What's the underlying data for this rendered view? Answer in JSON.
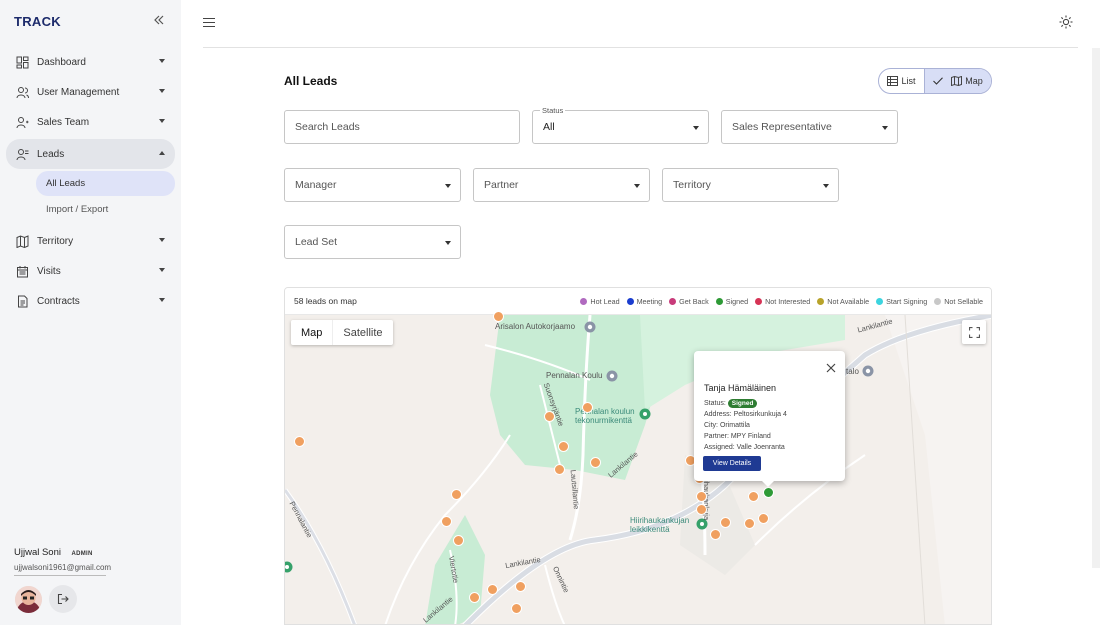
{
  "app": {
    "brand": "TRACK"
  },
  "sidebar": {
    "items": [
      {
        "label": "Dashboard",
        "icon": "dashboard-icon"
      },
      {
        "label": "User Management",
        "icon": "users-icon"
      },
      {
        "label": "Sales Team",
        "icon": "team-icon"
      },
      {
        "label": "Leads",
        "icon": "leads-icon",
        "expanded": true
      },
      {
        "label": "Territory",
        "icon": "map-icon"
      },
      {
        "label": "Visits",
        "icon": "calendar-icon"
      },
      {
        "label": "Contracts",
        "icon": "document-icon"
      }
    ],
    "sub_items": [
      "All Leads",
      "Import / Export"
    ],
    "user": {
      "name": "Ujjwal Soni",
      "role": "ADMIN",
      "email": "ujjwalsoni1961@gmail.com"
    }
  },
  "page": {
    "title": "All Leads",
    "view_toggle": {
      "list": "List",
      "map": "Map",
      "selected": "Map"
    }
  },
  "filters": {
    "search_placeholder": "Search Leads",
    "status_label": "Status",
    "status_value": "All",
    "sales_rep": "Sales Representative",
    "manager": "Manager",
    "partner": "Partner",
    "territory": "Territory",
    "lead_set": "Lead Set"
  },
  "map": {
    "count_text": "58 leads on map",
    "legend": [
      {
        "label": "Hot Lead",
        "color": "#b06abf"
      },
      {
        "label": "Meeting",
        "color": "#1a3dcf"
      },
      {
        "label": "Get Back",
        "color": "#c83b7a"
      },
      {
        "label": "Signed",
        "color": "#2e9a36"
      },
      {
        "label": "Not Interested",
        "color": "#d63355"
      },
      {
        "label": "Not Available",
        "color": "#b8a32a"
      },
      {
        "label": "Start Signing",
        "color": "#3cd4df"
      },
      {
        "label": "Not Sellable",
        "color": "#c8c8c8"
      }
    ],
    "type_buttons": [
      "Map",
      "Satellite"
    ],
    "places": [
      "Arisalon Autokorjaamo",
      "Pennalan Koulu",
      "Pennalan koulun tekonurmikenttä",
      "Hiirihaukankujan leikkikenttä",
      "talo"
    ],
    "roads": [
      "Lankilantie",
      "Pennalantie",
      "Suonsyrjäntie",
      "Lautsillantie",
      "Hiirihaukankuja",
      "Viertotie",
      "Onnintie"
    ],
    "popup": {
      "name": "Tanja Hämäläinen",
      "status_label": "Status:",
      "status_value": "Signed",
      "address": "Address: Peltosirkunkuja 4",
      "city": "City: Orimattila",
      "partner": "Partner: MPY Finland",
      "assigned": "Assigned: Valle Joenranta",
      "button": "View Details"
    }
  }
}
